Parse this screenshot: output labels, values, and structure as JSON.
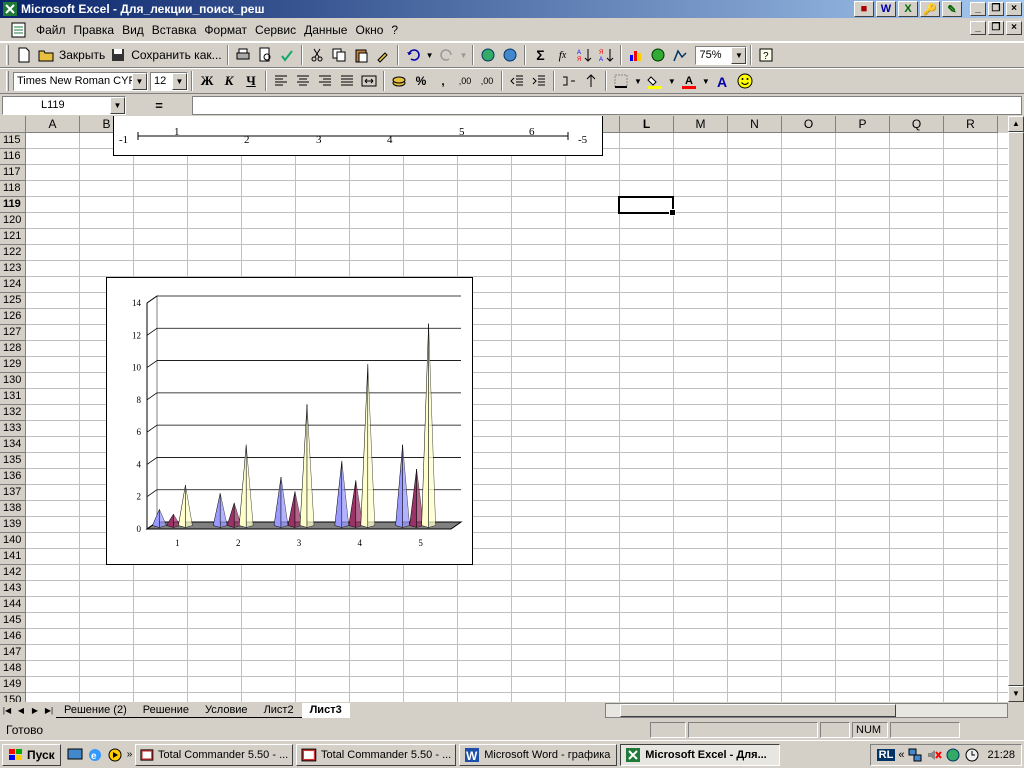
{
  "window": {
    "title": "Microsoft Excel - Для_лекции_поиск_реш",
    "quick_icons": [
      "W",
      "X",
      "🔑",
      "✎"
    ]
  },
  "menu": {
    "items": [
      "Файл",
      "Правка",
      "Вид",
      "Вставка",
      "Формат",
      "Сервис",
      "Данные",
      "Окно",
      "?"
    ]
  },
  "toolbar1": {
    "close_label": "Закрыть",
    "save_as_label": "Сохранить как...",
    "zoom": "75%"
  },
  "toolbar2": {
    "font_name": "Times New Roman CYR",
    "font_size": "12",
    "bold": "Ж",
    "italic": "К",
    "underline": "Ч",
    "percent": "%",
    "comma": ","
  },
  "formula_bar": {
    "name_box": "L119",
    "equals": "=",
    "formula": ""
  },
  "columns": [
    "A",
    "B",
    "C",
    "D",
    "E",
    "F",
    "G",
    "H",
    "I",
    "J",
    "K",
    "L",
    "M",
    "N",
    "O",
    "P",
    "Q",
    "R"
  ],
  "rows": [
    "115",
    "116",
    "117",
    "118",
    "119",
    "120",
    "121",
    "122",
    "123",
    "124",
    "125",
    "126",
    "127",
    "128",
    "129",
    "130",
    "131",
    "132",
    "133",
    "134",
    "135",
    "136",
    "137",
    "138",
    "139",
    "140",
    "141",
    "142",
    "143",
    "144",
    "145",
    "146",
    "147",
    "148",
    "149",
    "150"
  ],
  "active_row": "119",
  "partial_chart": {
    "left_label": "-1",
    "tick_labels": [
      "1",
      "2",
      "3",
      "4",
      "5",
      "6"
    ],
    "right_label": "-5"
  },
  "chart_data": {
    "type": "bar",
    "style": "3d-cone",
    "categories": [
      "1",
      "2",
      "3",
      "4",
      "5"
    ],
    "series": [
      {
        "color": "#9999ff",
        "values": [
          1,
          2,
          3,
          4,
          5
        ]
      },
      {
        "color": "#993366",
        "values": [
          0.7,
          1.4,
          2.1,
          2.8,
          3.5
        ]
      },
      {
        "color": "#ffffcc",
        "values": [
          2.5,
          5,
          7.5,
          10,
          12.5
        ]
      }
    ],
    "yticks": [
      "0",
      "2",
      "4",
      "6",
      "8",
      "10",
      "12",
      "14"
    ],
    "ylim": [
      0,
      14
    ],
    "grid": true
  },
  "sheet_tabs": [
    "Решение (2)",
    "Решение",
    "Условие",
    "Лист2",
    "Лист3"
  ],
  "active_tab": "Лист3",
  "status": {
    "text": "Готово",
    "num": "NUM"
  },
  "taskbar": {
    "start_label": "Пуск",
    "tasks": [
      "Total Commander 5.50 - ...",
      "Total Commander 5.50 - ...",
      "Microsoft Word - графика",
      "Microsoft Excel - Для..."
    ],
    "lang": "RL",
    "clock": "21:28"
  }
}
